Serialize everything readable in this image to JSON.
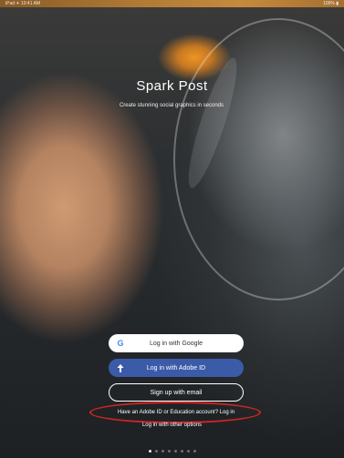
{
  "status_bar": {
    "left": "iPad ✈ 10:41 AM",
    "right": "100% ▮"
  },
  "app": {
    "name": "Spark Post",
    "tagline": "Create stunning social graphics in seconds"
  },
  "login": {
    "google": {
      "label": "Log in with Google",
      "icon": "google-g-icon"
    },
    "adobe": {
      "label": "Log in with Adobe ID",
      "icon": "upload-arrow-icon"
    },
    "email": {
      "label": "Sign up with email"
    },
    "education_link": "Have an Adobe ID or Education account? Log in",
    "other_link": "Log in with other options"
  },
  "page_indicator": {
    "count": 8,
    "active_index": 0
  },
  "colors": {
    "adobe_button": "#3b5ba9",
    "annotation_ellipse": "#d22424",
    "google_button": "#ffffff"
  }
}
